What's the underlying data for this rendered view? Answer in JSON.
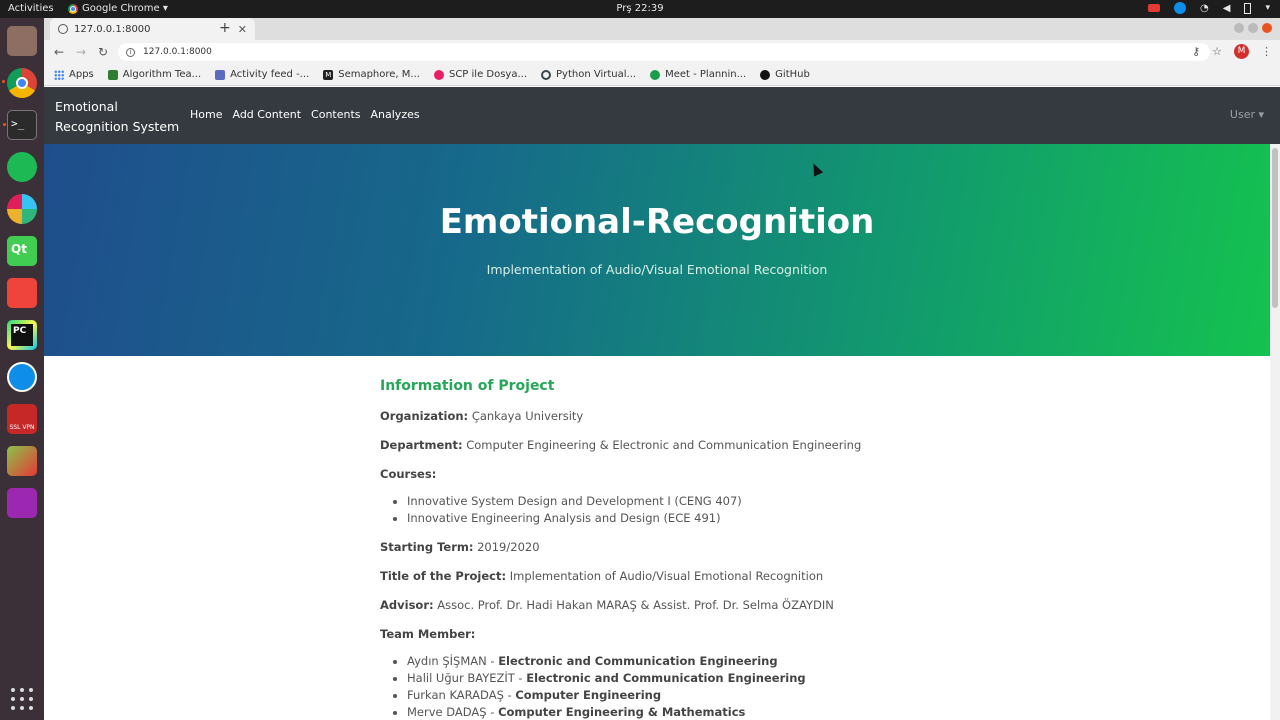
{
  "topbar": {
    "activities": "Activities",
    "app_name": "Google Chrome ▾",
    "clock": "Prş 22:39"
  },
  "browser": {
    "tab_title": "127.0.0.1:8000",
    "url": "127.0.0.1:8000",
    "profile_initial": "M",
    "bookmarks": [
      {
        "label": "Apps",
        "color": "#4285f4"
      },
      {
        "label": "Algorithm Tea...",
        "color": "#2e7d32"
      },
      {
        "label": "Activity feed -...",
        "color": "#5c6bc0"
      },
      {
        "label": "Semaphore, M...",
        "color": "#222222"
      },
      {
        "label": "SCP ile Dosya...",
        "color": "#e91e63"
      },
      {
        "label": "Python Virtual...",
        "color": "#37474f"
      },
      {
        "label": "Meet - Plannin...",
        "color": "#1a9e4b"
      },
      {
        "label": "GitHub",
        "color": "#111111"
      }
    ]
  },
  "navbar": {
    "brand_line1": "Emotional",
    "brand_line2": "Recognition System",
    "links": [
      "Home",
      "Add Content",
      "Contents",
      "Analyzes"
    ],
    "user": "User ▾"
  },
  "hero": {
    "title": "Emotional-Recognition",
    "subtitle": "Implementation of Audio/Visual Emotional Recognition"
  },
  "info": {
    "section_title": "Information of Project",
    "organization_label": "Organization:",
    "organization": "Çankaya University",
    "department_label": "Department:",
    "department": "Computer Engineering & Electronic and Communication Engineering",
    "courses_label": "Courses:",
    "courses": [
      "Innovative System Design and Development I (CENG 407)",
      "Innovative Engineering Analysis and Design (ECE 491)"
    ],
    "term_label": "Starting Term:",
    "term": "2019/2020",
    "project_title_label": "Title of the Project:",
    "project_title": "Implementation of Audio/Visual Emotional Recognition",
    "advisor_label": "Advisor:",
    "advisor": "Assoc. Prof. Dr. Hadi Hakan MARAŞ & Assist. Prof. Dr. Selma ÖZAYDIN",
    "team_label": "Team Member:",
    "team": [
      {
        "name": "Aydın ŞİŞMAN - ",
        "dept": "Electronic and Communication Engineering"
      },
      {
        "name": "Halil Uğur BAYEZİT - ",
        "dept": "Electronic and Communication Engineering"
      },
      {
        "name": "Furkan KARADAŞ - ",
        "dept": "Computer Engineering"
      },
      {
        "name": "Merve DADAŞ - ",
        "dept": "Computer Engineering & Mathematics"
      }
    ]
  },
  "dock_apps": [
    {
      "name": "files-icon",
      "color": "#8d6e63"
    },
    {
      "name": "chrome-icon",
      "color": "#4285f4"
    },
    {
      "name": "terminal-icon",
      "color": "#2b2b2b"
    },
    {
      "name": "spotify-icon",
      "color": "#1db954"
    },
    {
      "name": "slack-icon",
      "color": "#e01e5a"
    },
    {
      "name": "qt-creator-icon",
      "color": "#41cd52"
    },
    {
      "name": "anydesk-icon",
      "color": "#ef443b"
    },
    {
      "name": "pycharm-icon",
      "color": "#21d789"
    },
    {
      "name": "teamviewer-icon",
      "color": "#0e8ee9"
    },
    {
      "name": "ssl-vpn-icon",
      "color": "#c62828"
    },
    {
      "name": "inkscape-icon",
      "color": "#8bc34a"
    },
    {
      "name": "video-icon",
      "color": "#9c27b0"
    }
  ]
}
